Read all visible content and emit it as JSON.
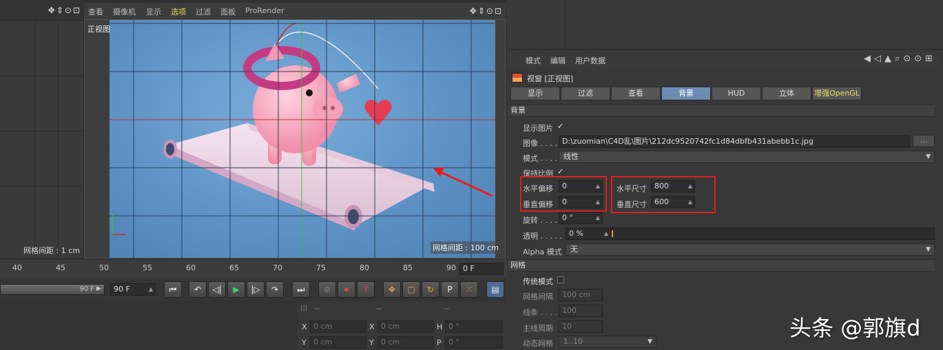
{
  "viewport": {
    "menu": [
      "查看",
      "摄像机",
      "显示",
      "选项",
      "过滤",
      "面板",
      "ProRender"
    ],
    "active_menu": "选项",
    "view_label": "正视图",
    "grid_label": "网格间距 : 100 cm",
    "controls": "✥⇕⊙⊡"
  },
  "left_panel": {
    "grid_label": "网格间距 : 1 cm",
    "controls": "✥⇕⊙⊡"
  },
  "attributes": {
    "menu": [
      "模式",
      "编辑",
      "用户数据"
    ],
    "object_title": "视窗 [正视图]",
    "tabs": [
      "显示",
      "过滤",
      "查看",
      "背景",
      "HUD",
      "立体",
      "增强OpenGL"
    ],
    "active_tab": "背景",
    "section_background": "背景",
    "show_image_label": "显示图片",
    "check": "✓",
    "image_label": "图像 . . . .",
    "image_path": "D:\\zuomian\\C4D乱\\图片\\212dc9520742fc1d84dbfb431abebb1c.jpg",
    "browse_label": "...",
    "mode_label": "模式 . . . .",
    "mode_value": "线性",
    "keep_ratio_label": "保持比例",
    "h_offset_label": "水平偏移",
    "h_offset_value": "0",
    "v_offset_label": "垂直偏移",
    "v_offset_value": "0",
    "h_size_label": "水平尺寸",
    "h_size_value": "800",
    "v_size_label": "垂直尺寸",
    "v_size_value": "600",
    "rotate_label": "旋转 . . . .",
    "rotate_value": "0 °",
    "transparency_label": "透明 . . . . .",
    "transparency_value": "0 %",
    "alpha_label": "Alpha 模式",
    "alpha_value": "无",
    "section_grid": "网格",
    "legacy_label": "传统模式",
    "grid_spacing_label": "网格间隔",
    "grid_spacing_value": "100 cm",
    "lines_label": "线条 . . . .",
    "lines_value": "100",
    "major_label": "主线周期",
    "major_value": "10",
    "dynamic_label": "动态网格",
    "dynamic_value": "1..10"
  },
  "timeline": {
    "ticks": [
      "40",
      "45",
      "50",
      "55",
      "60",
      "65",
      "70",
      "75",
      "80",
      "85",
      "90"
    ],
    "frame_field": "0 F"
  },
  "transport": {
    "range_label": "90 F",
    "end_field": "90 F",
    "buttons": [
      "⏮",
      "↶",
      "◁|",
      "▶",
      "|▷",
      "↷",
      "⏭",
      "⊘",
      "⏺",
      "?",
      "✥",
      "▢",
      "↻",
      "P",
      "⁙",
      "▤"
    ]
  },
  "coords": {
    "header": [
      "--",
      "--",
      "--"
    ],
    "rows": [
      [
        {
          "axis": "X",
          "value": "0 cm"
        },
        {
          "axis": "X",
          "value": "0 cm"
        },
        {
          "axis": "H",
          "value": "0 °"
        }
      ],
      [
        {
          "axis": "Y",
          "value": "0 cm"
        },
        {
          "axis": "Y",
          "value": "0 cm"
        },
        {
          "axis": "P",
          "value": "0 °"
        }
      ]
    ]
  },
  "watermark": "头条 @郭旗d",
  "colors": {
    "active_tab": "#6b8bb3",
    "highlight": "#f0dc5a",
    "annotation": "#e02020",
    "scene": "#6a9ed0"
  }
}
